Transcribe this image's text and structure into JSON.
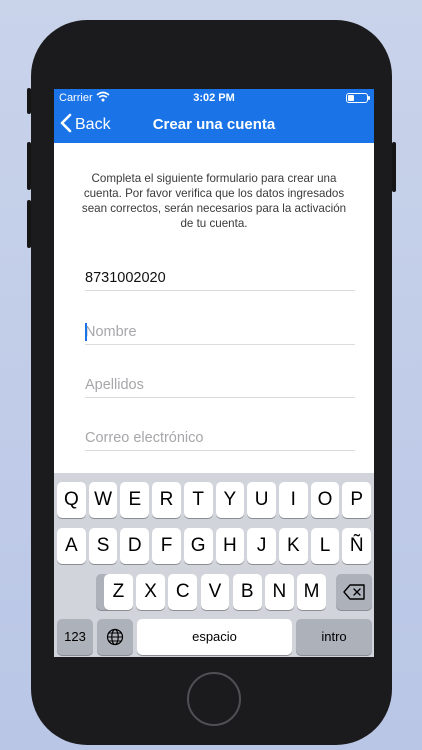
{
  "status_bar": {
    "carrier": "Carrier",
    "time": "3:02 PM",
    "battery_level": 0.35
  },
  "nav": {
    "back_label": "Back",
    "title": "Crear una cuenta"
  },
  "form": {
    "intro": "Completa el siguiente formulario para crear una cuenta. Por favor verifica que los datos ingresados sean correctos, serán necesarios para la activación de tu cuenta.",
    "phone_value": "8731002020",
    "name_placeholder": "Nombre",
    "lastname_placeholder": "Apellidos",
    "email_placeholder": "Correo electrónico"
  },
  "keyboard": {
    "row1": [
      "Q",
      "W",
      "E",
      "R",
      "T",
      "Y",
      "U",
      "I",
      "O",
      "P"
    ],
    "row2": [
      "A",
      "S",
      "D",
      "F",
      "G",
      "H",
      "J",
      "K",
      "L",
      "Ñ"
    ],
    "row3": [
      "Z",
      "X",
      "C",
      "V",
      "B",
      "N",
      "M"
    ],
    "numbers_label": "123",
    "space_label": "espacio",
    "return_label": "intro"
  },
  "colors": {
    "accent": "#1a74e8",
    "keyboard_bg": "#d1d4da"
  }
}
